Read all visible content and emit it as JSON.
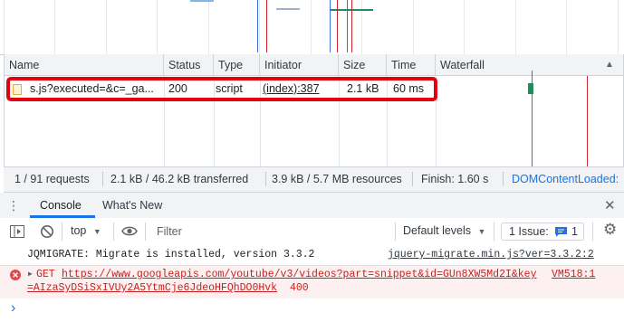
{
  "network": {
    "columns": [
      "Name",
      "Status",
      "Type",
      "Initiator",
      "Size",
      "Time",
      "Waterfall"
    ],
    "sort_indicator": "▲",
    "row": {
      "name": "s.js?executed=&c=_ga...",
      "status": "200",
      "type": "script",
      "initiator": "(index):387",
      "size": "2.1 kB",
      "time": "60 ms"
    }
  },
  "summary": {
    "requests": "1 / 91 requests",
    "transferred": "2.1 kB / 46.2 kB transferred",
    "resources": "3.9 kB / 5.7 MB resources",
    "finish": "Finish: 1.60 s",
    "dom_content_loaded": "DOMContentLoaded:"
  },
  "drawer": {
    "tabs": [
      "Console",
      "What's New"
    ],
    "active_tab": "Console"
  },
  "console_toolbar": {
    "context": "top",
    "filter_placeholder": "Filter",
    "levels": "Default levels",
    "issues_label": "1 Issue:",
    "issues_count": "1"
  },
  "console": {
    "messages": [
      {
        "level": "info",
        "text": "JQMIGRATE: Migrate is installed, version 3.3.2",
        "source": "jquery-migrate.min.js?ver=3.3.2:2"
      },
      {
        "level": "error",
        "method": "GET",
        "url_line1": "https://www.googleapis.com/youtube/v3/videos?part=snippet&id=GUn8XW5Md2I&key",
        "source": "VM518:1",
        "url_line2": "=AIzaSyDSiSxIVUy2A5YtmCje6JdeoHFQhDO0Hvk",
        "code": "400"
      }
    ],
    "prompt": "›"
  },
  "colors": {
    "highlight": "#e3000f",
    "link_blue": "#1a73e8",
    "error_red": "#c5221f",
    "waterfall_green": "#1e8f5a"
  }
}
